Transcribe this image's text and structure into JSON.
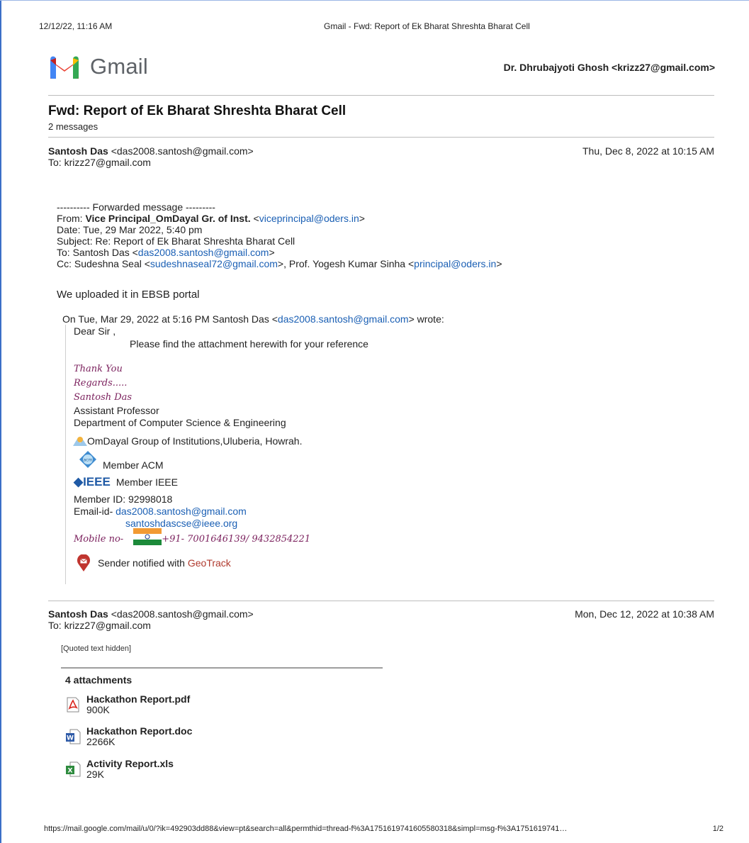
{
  "print_header": {
    "datetime": "12/12/22, 11:16 AM",
    "page_title": "Gmail - Fwd: Report of Ek Bharat Shreshta Bharat Cell"
  },
  "brand": {
    "wordmark": "Gmail",
    "account": "Dr. Dhrubajyoti Ghosh <krizz27@gmail.com>"
  },
  "thread": {
    "subject": "Fwd: Report of Ek Bharat Shreshta Bharat Cell",
    "count": "2 messages"
  },
  "message1": {
    "sender_name": "Santosh Das",
    "sender_email": "<das2008.santosh@gmail.com>",
    "date": "Thu, Dec 8, 2022 at 10:15 AM",
    "to": "To: krizz27@gmail.com",
    "forward": {
      "divider": "---------- Forwarded message ---------",
      "from_label": "From: ",
      "from_name": "Vice Principal_OmDayal Gr. of Inst.",
      "from_email": "viceprincipal@oders.in",
      "date": "Date: Tue, 29 Mar 2022, 5:40 pm",
      "subject": "Subject: Re: Report of Ek Bharat Shreshta Bharat Cell",
      "to_label": "To: Santosh Das <",
      "to_email": "das2008.santosh@gmail.com",
      "cc_label": "Cc: Sudeshna Seal <",
      "cc_email1": "sudeshnaseal72@gmail.com",
      "cc_mid": ">, Prof. Yogesh Kumar Sinha <",
      "cc_email2": "principal@oders.in"
    },
    "reply": "We uploaded it in EBSB portal",
    "quote": {
      "intro_pre": "On Tue, Mar 29, 2022 at 5:16 PM Santosh Das <",
      "intro_email": "das2008.santosh@gmail.com",
      "intro_post": "> wrote:",
      "greeting": "Dear Sir ,",
      "body": "Please find the attachment herewith for your reference",
      "thanks": "Thank You",
      "regards": "Regards.....",
      "sig_name": "Santosh Das",
      "title": "Assistant Professor",
      "dept": "Department of Computer Science & Engineering",
      "institution": "OmDayal Group of Institutions,Uluberia, Howrah.",
      "acm": "Member ACM",
      "ieee_logo": "IEEE",
      "ieee": "Member IEEE",
      "member_id": "Member ID: 92998018",
      "email_label": "Email-id- ",
      "email1": "das2008.santosh@gmail.com",
      "email2": "santoshdascse@ieee.org",
      "mobile_label": "Mobile no-",
      "mobile": "+91- 7001646139/ 9432854221",
      "geotrack_pre": "Sender notified with ",
      "geotrack": "GeoTrack"
    }
  },
  "message2": {
    "sender_name": "Santosh Das",
    "sender_email": "<das2008.santosh@gmail.com>",
    "date": "Mon, Dec 12, 2022 at 10:38 AM",
    "to": "To: krizz27@gmail.com",
    "quoted_hidden": "[Quoted text hidden]",
    "attachments_title": "4 attachments",
    "attachments": [
      {
        "name": "Hackathon Report.pdf",
        "size": "900K",
        "icon": "pdf-file-icon"
      },
      {
        "name": "Hackathon Report.doc",
        "size": "2266K",
        "icon": "word-file-icon"
      },
      {
        "name": "Activity Report.xls",
        "size": "29K",
        "icon": "excel-file-icon"
      }
    ]
  },
  "footer": {
    "url": "https://mail.google.com/mail/u/0/?ik=492903dd88&view=pt&search=all&permthid=thread-f%3A1751619741605580318&simpl=msg-f%3A1751619741…",
    "page": "1/2"
  }
}
